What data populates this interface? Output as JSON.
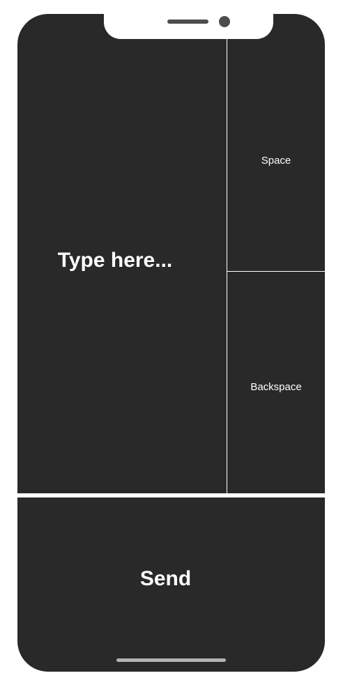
{
  "keyboard": {
    "type_area_label": "Type here...",
    "space_label": "Space",
    "backspace_label": "Backspace",
    "send_label": "Send"
  },
  "colors": {
    "surface": "#292929",
    "text": "#ffffff",
    "divider": "#ffffff",
    "notch_details": "#4d4d4d",
    "home_indicator": "#b3b3b3"
  }
}
